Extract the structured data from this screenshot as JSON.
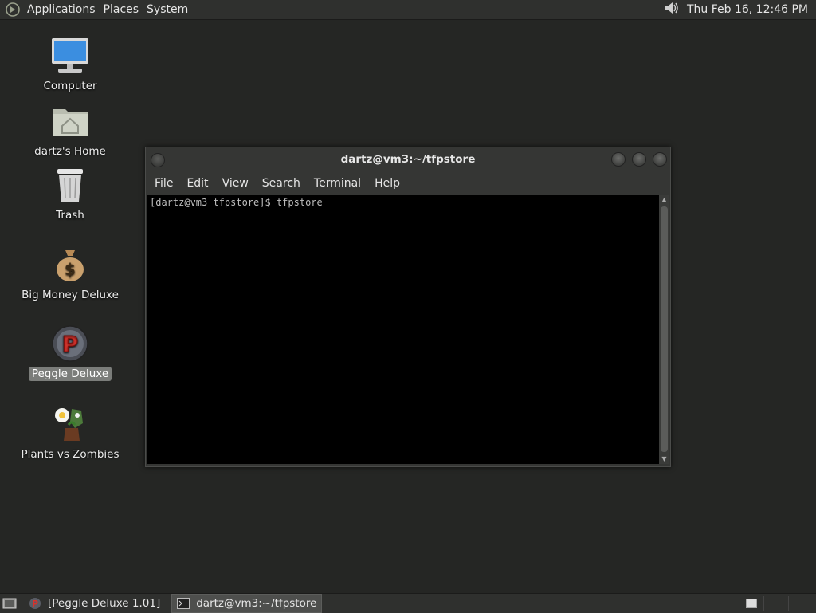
{
  "top_panel": {
    "menus": [
      "Applications",
      "Places",
      "System"
    ],
    "clock": "Thu Feb 16, 12:46 PM",
    "volume_icon": "speaker-icon"
  },
  "desktop": {
    "icons": [
      {
        "label": "Computer",
        "icon": "computer-icon"
      },
      {
        "label": "dartz's Home",
        "icon": "home-folder-icon"
      },
      {
        "label": "Trash",
        "icon": "trash-icon"
      },
      {
        "label": "Big Money Deluxe",
        "icon": "money-bag-icon"
      },
      {
        "label": "Peggle Deluxe",
        "icon": "peggle-icon"
      },
      {
        "label": "Plants vs Zombies",
        "icon": "plants-vs-zombies-icon"
      }
    ]
  },
  "terminal": {
    "title": "dartz@vm3:~/tfpstore",
    "menu": [
      "File",
      "Edit",
      "View",
      "Search",
      "Terminal",
      "Help"
    ],
    "prompt_line": "[dartz@vm3 tfpstore]$ tfpstore"
  },
  "bottom_panel": {
    "tasks": [
      {
        "label": "[Peggle Deluxe 1.01]",
        "icon": "peggle-icon"
      },
      {
        "label": "dartz@vm3:~/tfpstore",
        "icon": "terminal-icon"
      }
    ]
  },
  "colors": {
    "desktop_bg": "#252624",
    "panel_bg": "#2f302e",
    "terminal_bg": "#000000"
  }
}
